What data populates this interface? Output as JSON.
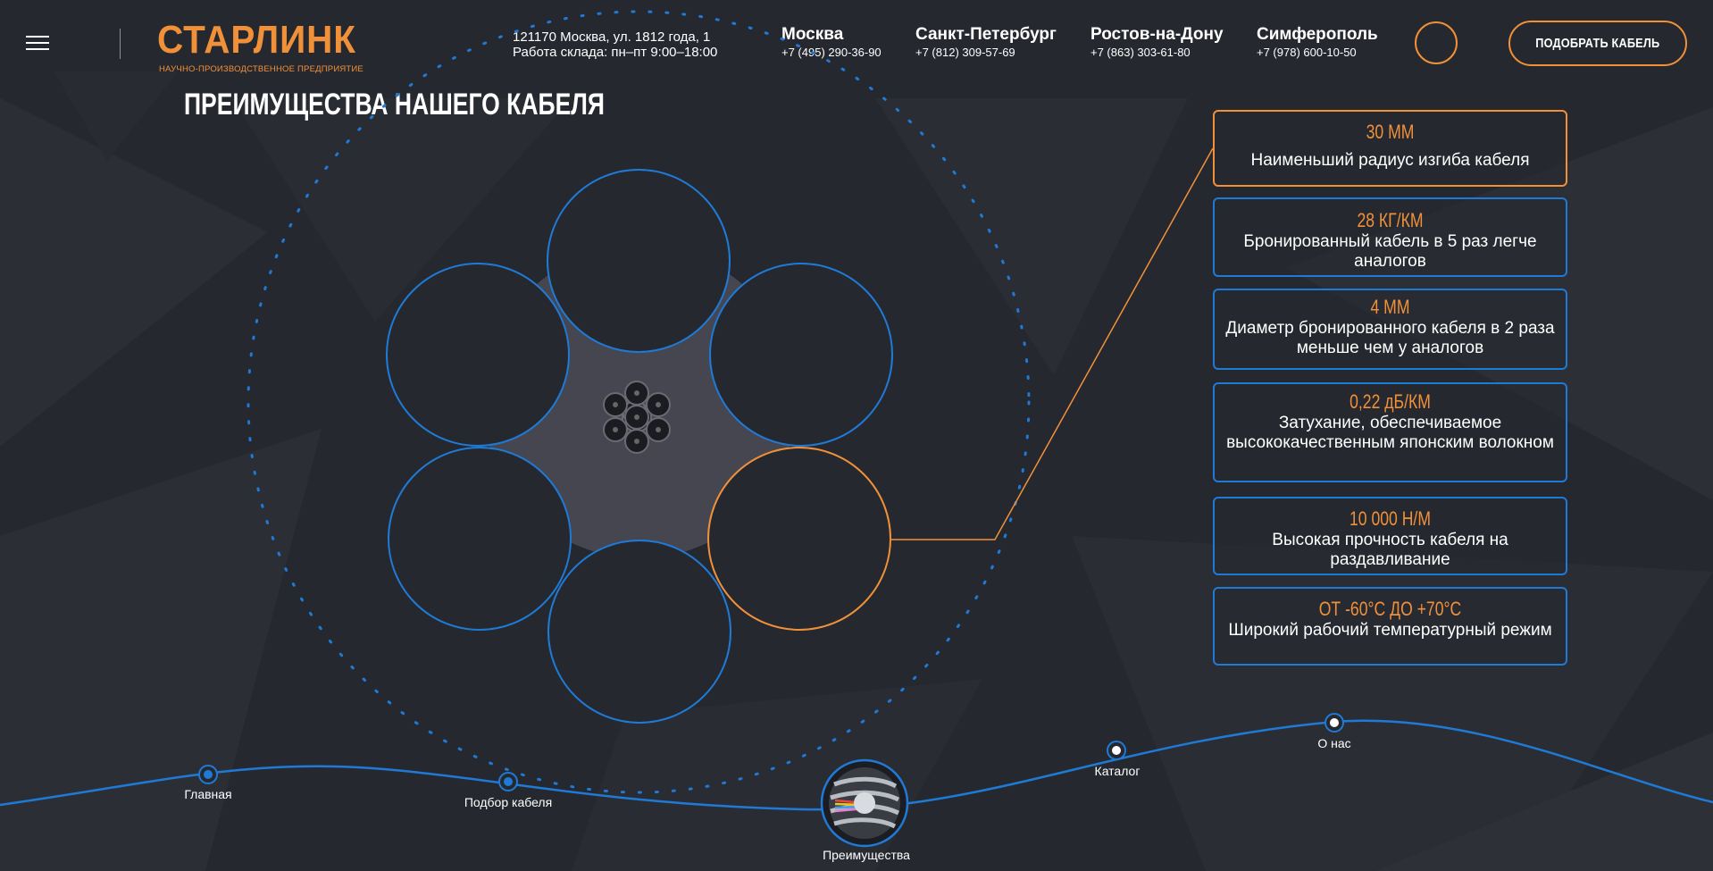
{
  "header": {
    "logo": "СТАРЛИНК",
    "logo_subtitle": "НАУЧНО-ПРОИЗВОДСТВЕННОЕ ПРЕДПРИЯТИЕ",
    "address_line1": "121170 Москва, ул. 1812 года, 1",
    "address_line2": "Работа склада: пн–пт 9:00–18:00",
    "cities": [
      {
        "name": "Москва",
        "phone": "+7 (495) 290-36-90"
      },
      {
        "name": "Санкт-Петербург",
        "phone": "+7 (812) 309-57-69"
      },
      {
        "name": "Ростов-на-Дону",
        "phone": "+7 (863) 303-61-80"
      },
      {
        "name": "Симферополь",
        "phone": "+7 (978) 600-10-50"
      }
    ],
    "pick_cable_button": "ПОДОБРАТЬ КАБЕЛЬ"
  },
  "section_title": "ПРЕИМУЩЕСТВА НАШЕГО КАБЕЛЯ",
  "advantages": [
    {
      "value": "30 ММ",
      "text": "Наименьший радиус изгиба кабеля",
      "active": true
    },
    {
      "value": "28 КГ/КМ",
      "text": "Бронированный кабель в 5 раз легче аналогов",
      "active": false
    },
    {
      "value": "4 ММ",
      "text": "Диаметр бронированного кабеля в 2 раза меньше чем у аналогов",
      "active": false
    },
    {
      "value": "0,22 дБ/КМ",
      "text": "Затухание, обеспечиваемое высококачественным японским волокном",
      "active": false
    },
    {
      "value": "10 000 Н/М",
      "text": "Высокая прочность кабеля на раздавливание",
      "active": false
    },
    {
      "value": "ОТ -60°С ДО +70°С",
      "text": "Широкий рабочий температурный режим",
      "active": false
    }
  ],
  "nav": {
    "items": [
      {
        "label": "Главная"
      },
      {
        "label": "Подбор кабеля"
      },
      {
        "label": "Преимущества",
        "current": true
      },
      {
        "label": "Каталог"
      },
      {
        "label": "О нас"
      }
    ]
  },
  "colors": {
    "background": "#26282f",
    "accent": "#f0913a",
    "blue": "#1f7ad6",
    "core": "#45464f"
  }
}
